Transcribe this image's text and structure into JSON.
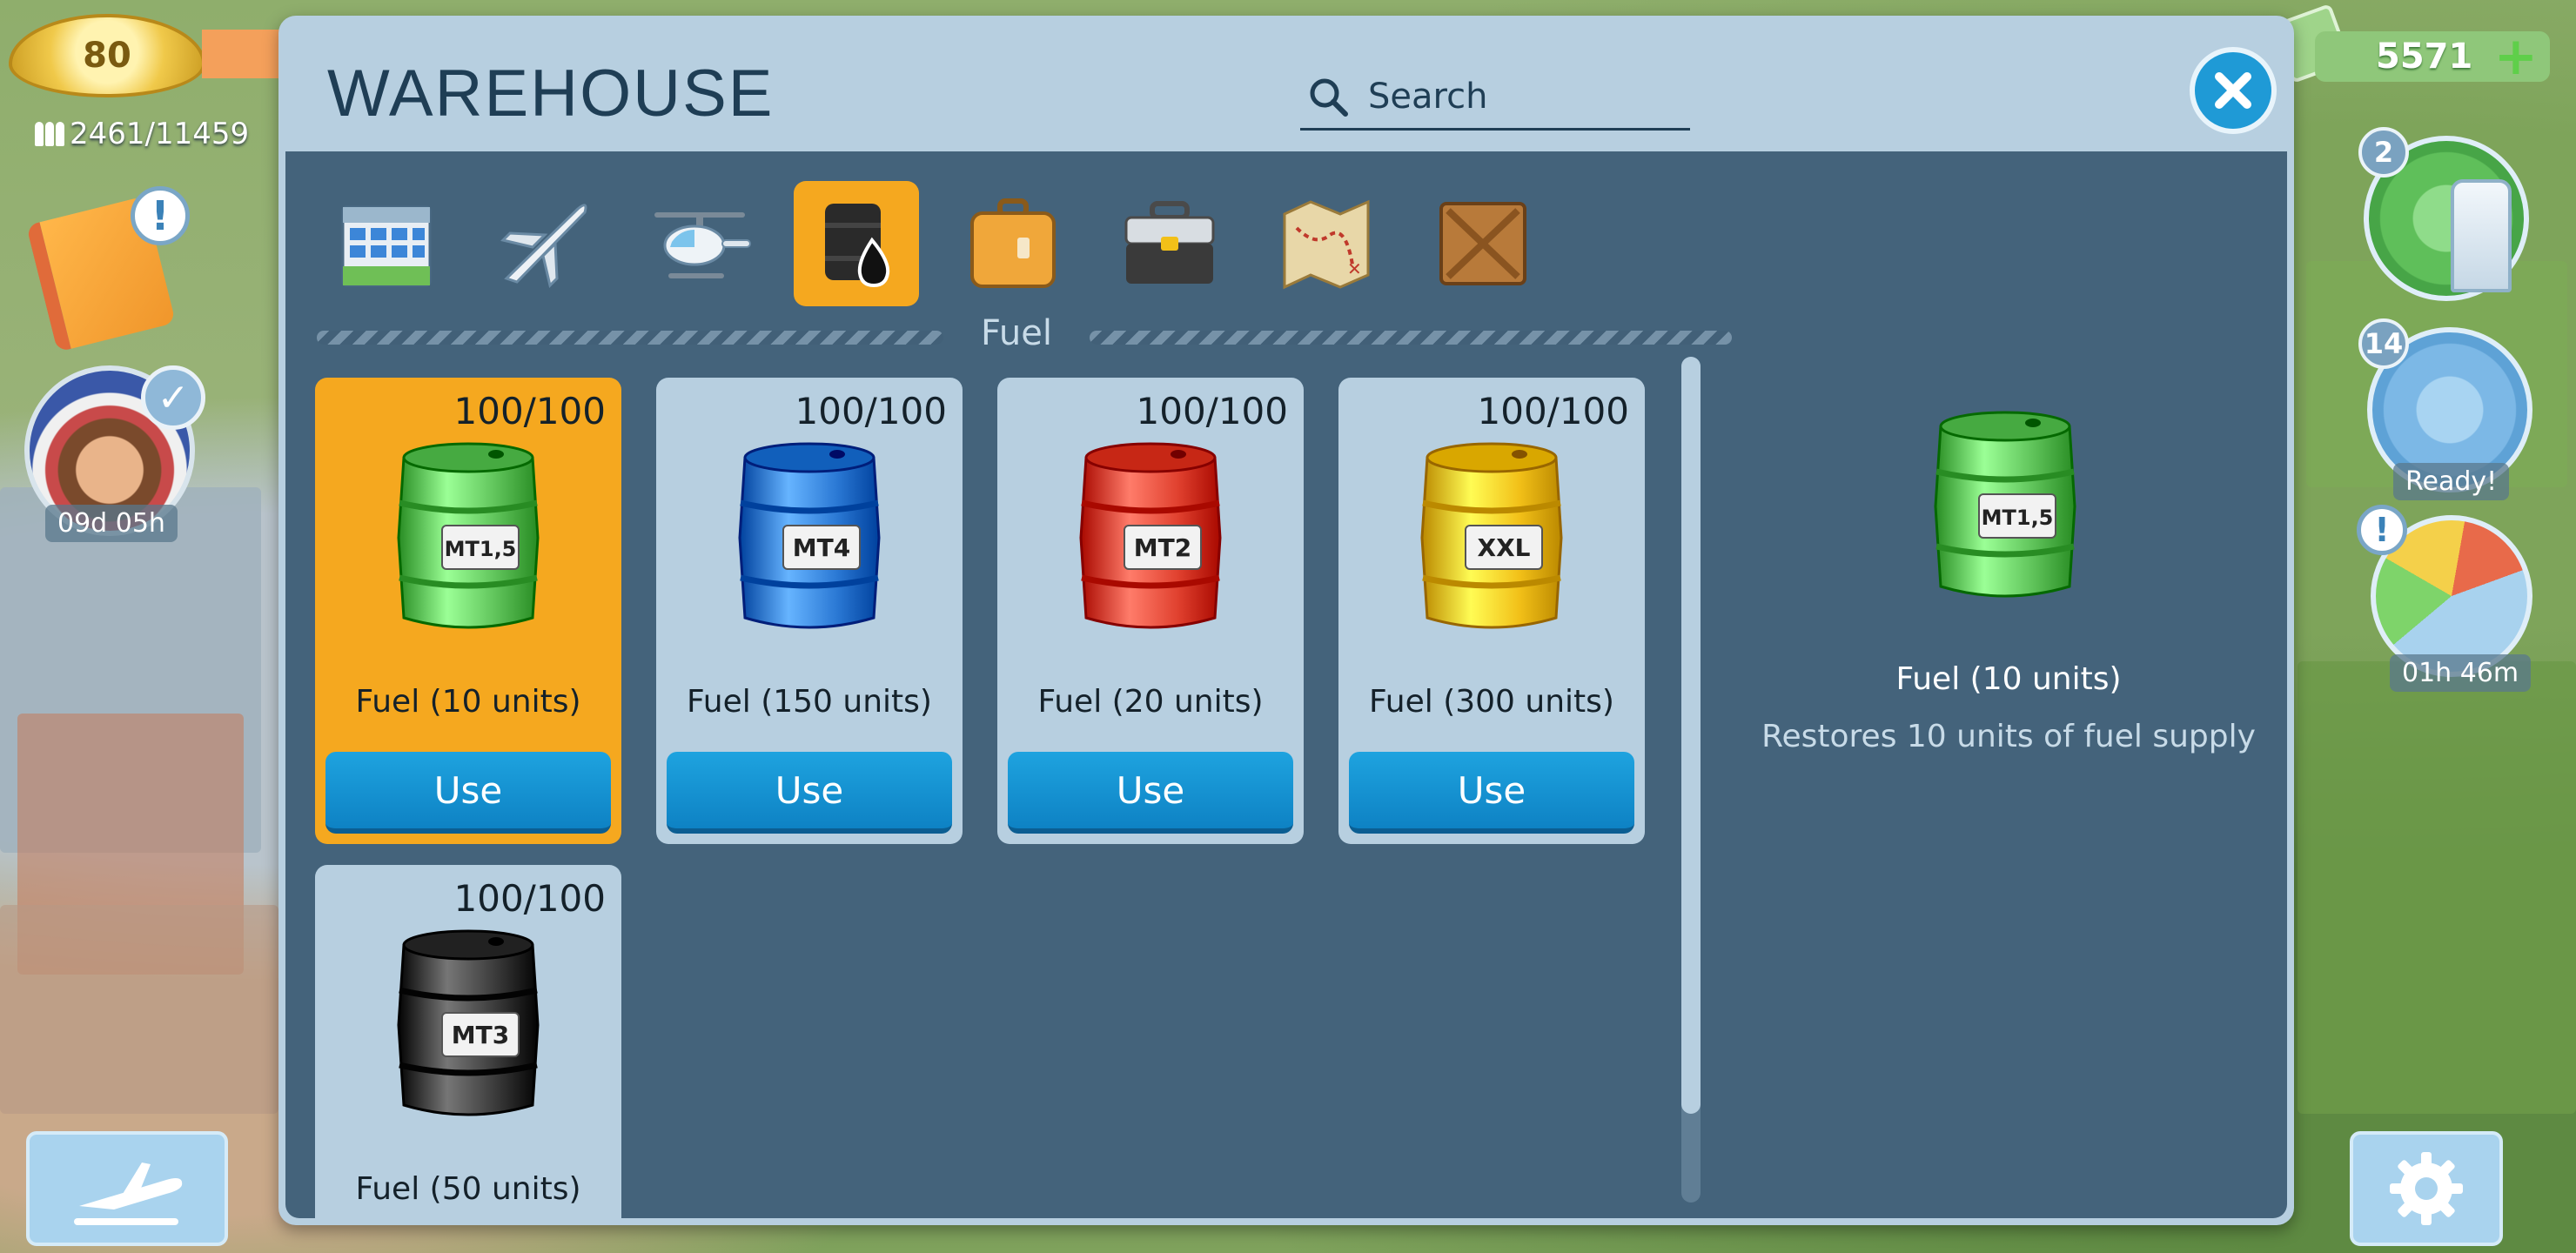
{
  "hud": {
    "level": "80",
    "population": "2461/11459",
    "event_timer": "09d 05h",
    "cash": "5571",
    "radar_1_count": "2",
    "radar_2_count": "14",
    "radar_2_status": "Ready!",
    "gauge_timer": "01h 46m"
  },
  "modal": {
    "title": "WAREHOUSE",
    "search_placeholder": "Search",
    "section_label": "Fuel",
    "categories": [
      {
        "name": "buildings",
        "icon": "building-icon"
      },
      {
        "name": "airplanes",
        "icon": "airplane-icon"
      },
      {
        "name": "helicopters",
        "icon": "helicopter-icon"
      },
      {
        "name": "fuel",
        "icon": "oil-barrel-icon",
        "active": true
      },
      {
        "name": "luggage",
        "icon": "suitcase-icon"
      },
      {
        "name": "tools",
        "icon": "toolbox-icon"
      },
      {
        "name": "maps",
        "icon": "treasure-map-icon"
      },
      {
        "name": "crates",
        "icon": "wooden-crate-icon"
      }
    ],
    "items": [
      {
        "quantity": "100/100",
        "name": "Fuel (10 units)",
        "label": "MT1,5",
        "color": "#5fc35a",
        "selected": true,
        "button": "Use"
      },
      {
        "quantity": "100/100",
        "name": "Fuel (150 units)",
        "label": "MT4",
        "color": "#2a78d4",
        "button": "Use"
      },
      {
        "quantity": "100/100",
        "name": "Fuel (20 units)",
        "label": "MT2",
        "color": "#e0402e",
        "button": "Use"
      },
      {
        "quantity": "100/100",
        "name": "Fuel (300 units)",
        "label": "XXL",
        "color": "#f2c018",
        "button": "Use"
      },
      {
        "quantity": "100/100",
        "name": "Fuel (50 units)",
        "label": "MT3",
        "color": "#3a3a3a"
      }
    ],
    "detail": {
      "name": "Fuel (10 units)",
      "description": "Restores 10 units of fuel supply",
      "label": "MT1,5",
      "color": "#5fc35a"
    }
  }
}
